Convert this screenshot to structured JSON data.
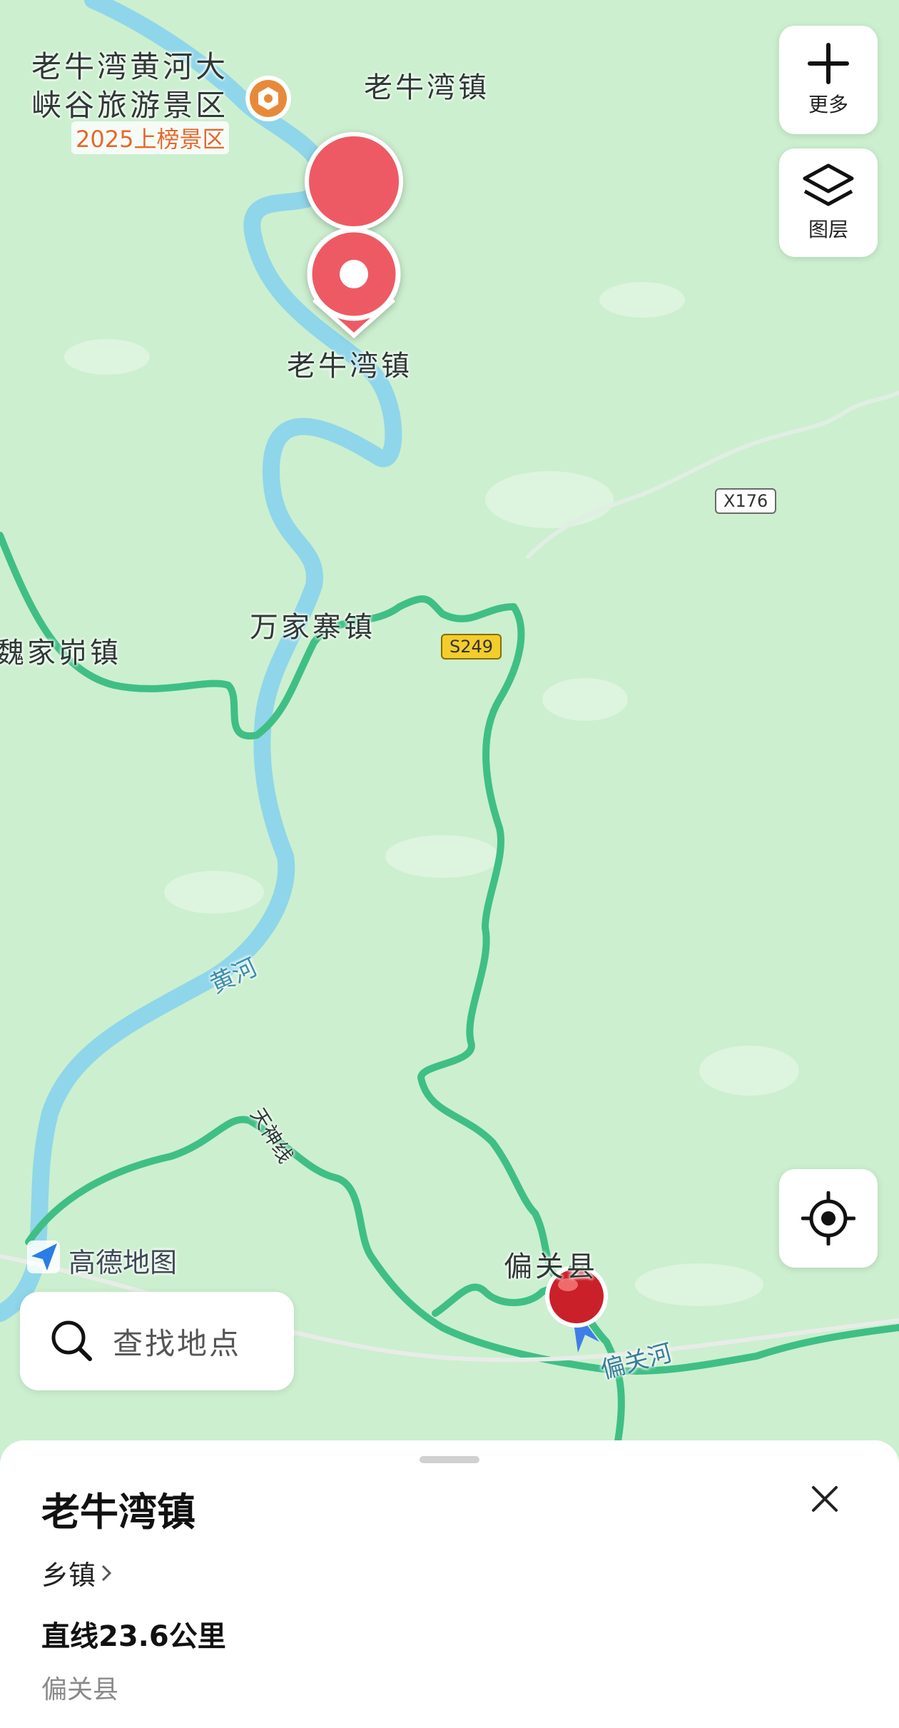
{
  "map": {
    "labels": {
      "scenic_name_line1": "老牛湾黄河大",
      "scenic_name_line2": "峡谷旅游景区",
      "scenic_tag": "2025上榜景区",
      "town_top": "老牛湾镇",
      "marker_label": "老牛湾镇",
      "wanjiazhai": "万家寨镇",
      "weijiamao": "魏家峁镇",
      "river": "黄河",
      "tianshen_road": "天神线",
      "pianguan_county": "偏关县",
      "pianguan_river": "偏关河",
      "watermark": "高德地图"
    },
    "road_badges": {
      "x176": "X176",
      "s249": "S249"
    },
    "colors": {
      "land": "#ccefcf",
      "river": "#8fd6ea",
      "road": "#3fbf85",
      "marker": "#ee5a63",
      "tag": "#e5682a"
    }
  },
  "controls": {
    "more_label": "更多",
    "layers_label": "图层"
  },
  "search": {
    "placeholder": "查找地点"
  },
  "sheet": {
    "title": "老牛湾镇",
    "category": "乡镇",
    "distance": "直线23.6公里",
    "region": "偏关县"
  }
}
